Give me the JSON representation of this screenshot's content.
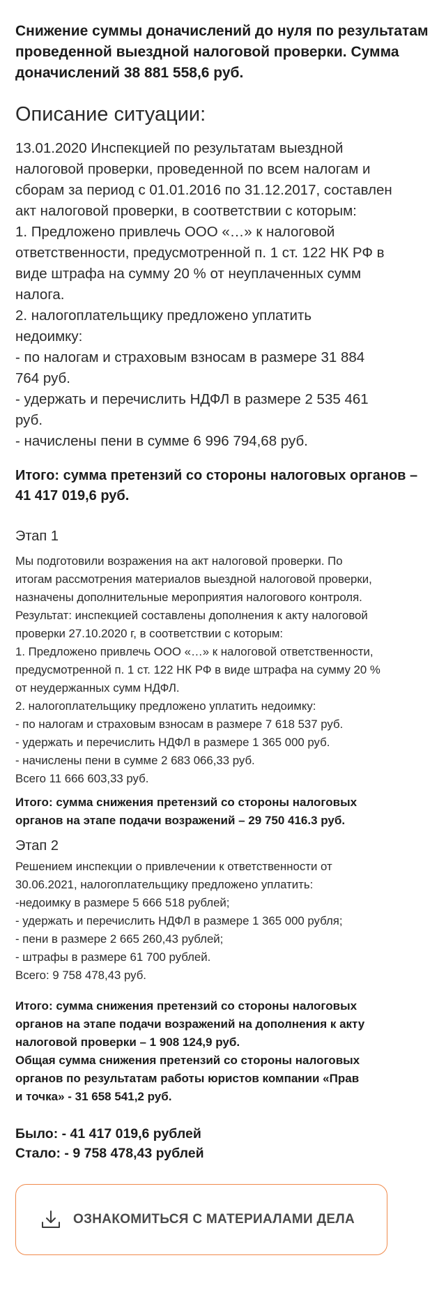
{
  "headline": "Снижение суммы доначислений до нуля по результатам проведенной  выездной налоговой проверки. Сумма доначислений 38 881 558,6 руб.",
  "situation": {
    "title": "Описание ситуации:",
    "lines": [
      "13.01.2020 Инспекцией по результатам выездной",
      "налоговой проверки, проведенной по всем налогам и",
      "сборам за период с 01.01.2016 по 31.12.2017, составлен",
      "акт налоговой проверки, в соответствии с которым:",
      "1. Предложено привлечь ООО «…» к налоговой",
      "ответственности, предусмотренной п. 1 ст. 122 НК РФ в",
      "виде штрафа на сумму 20 % от неуплаченных сумм",
      "налога.",
      "2. налогоплательщику предложено уплатить",
      "недоимку:",
      "- по налогам и страховым взносам в размере 31 884",
      "764 руб.",
      "- удержать и перечислить НДФЛ в размере 2 535 461",
      "руб.",
      "- начислены пени в сумме 6 996 794,68 руб."
    ],
    "total": "Итого: сумма претензий со стороны налоговых органов – 41 417 019,6 руб."
  },
  "stage1": {
    "title": "Этап 1",
    "lines": [
      "Мы подготовили возражения на акт налоговой проверки. По",
      "итогам рассмотрения материалов выездной налоговой проверки,",
      "назначены дополнительные мероприятия налогового контроля.",
      "Результат: инспекцией составлены дополнения к акту налоговой",
      "проверки 27.10.2020 г, в соответствии с которым:",
      "1. Предложено привлечь ООО «…» к налоговой ответственности,",
      "предусмотренной п. 1 ст. 122 НК РФ в виде штрафа на сумму 20 %",
      "от неудержанных сумм НДФЛ.",
      "2. налогоплательщику предложено уплатить недоимку:",
      "- по налогам и страховым взносам в размере 7 618 537 руб.",
      "- удержать и перечислить НДФЛ в размере 1 365 000 руб.",
      "- начислены пени в сумме 2 683 066,33 руб.",
      "Всего 11 666 603,33 руб."
    ],
    "result_lines": [
      "Итого: сумма снижения претензий со стороны налоговых",
      "органов на этапе подачи возражений – 29 750 416.3 руб."
    ]
  },
  "stage2": {
    "title": "Этап 2",
    "lines": [
      "Решением инспекции о привлечении к ответственности от",
      "30.06.2021, налогоплательщику предложено уплатить:",
      "-недоимку в размере 5 666 518 рублей;",
      "- удержать и перечислить НДФЛ в размере 1 365 000 рубля;",
      "- пени в размере 2 665 260,43 рублей;",
      "- штрафы в размере 61 700 рублей.",
      "Всего: 9 758 478,43 руб."
    ],
    "result_lines": [
      "Итого: сумма снижения претензий со стороны налоговых",
      "органов на этапе подачи возражений на дополнения к акту",
      "налоговой проверки – 1 908 124,9 руб.",
      "Общая сумма снижения претензий со стороны налоговых",
      "органов по результатам работы юристов компании «Прав",
      "и точка» - 31 658 541,2 руб."
    ]
  },
  "summary": {
    "before": "Было: - 41 417 019,6 рублей",
    "after": "Стало: - 9 758 478,43 рублей"
  },
  "materials_button": {
    "label": "ОЗНАКОМИТЬСЯ С МАТЕРИАЛАМИ ДЕЛА",
    "icon": "download-icon",
    "border_color": "#f08a4b"
  }
}
